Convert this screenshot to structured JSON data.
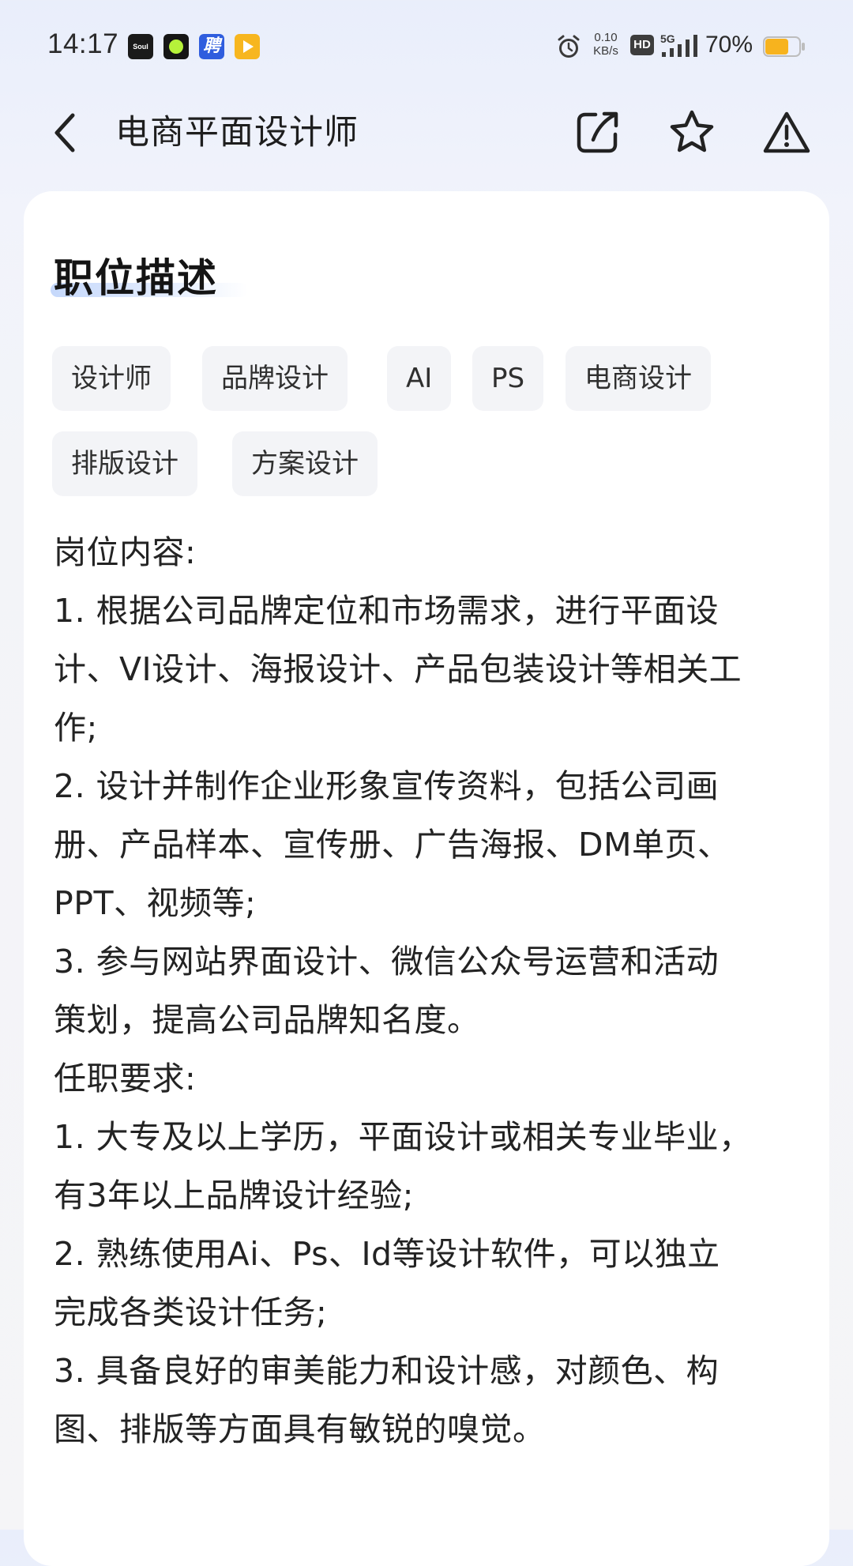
{
  "status_bar": {
    "time": "14:17",
    "notification_icons": [
      "soul-app-icon",
      "circle-app-icon",
      "recruit-app-icon",
      "video-app-icon"
    ],
    "soul_label": "Soul",
    "recruit_label": "聘",
    "net_speed_value": "0.10",
    "net_speed_unit": "KB/s",
    "hd_label": "HD",
    "network_label": "5G",
    "battery_percent": "70%",
    "battery_level": 0.7,
    "battery_color": "#f7b31e"
  },
  "nav": {
    "title": "电商平面设计师",
    "actions": [
      "back-arrow-icon",
      "share-icon",
      "star-icon",
      "warning-icon"
    ]
  },
  "section": {
    "title": "职位描述",
    "accent_color": "#c5d8fb"
  },
  "tags": [
    "设计师",
    "品牌设计",
    "AI",
    "PS",
    "电商设计",
    "排版设计",
    "方案设计"
  ],
  "description_lines": [
    "岗位内容:",
    "1. 根据公司品牌定位和市场需求，进行平面设",
    "计、VI设计、海报设计、产品包装设计等相关工",
    "作;",
    "2. 设计并制作企业形象宣传资料，包括公司画",
    "册、产品样本、宣传册、广告海报、DM单页、",
    "PPT、视频等;",
    "3. 参与网站界面设计、微信公众号运营和活动",
    "策划，提高公司品牌知名度。",
    "任职要求:",
    "1. 大专及以上学历，平面设计或相关专业毕业，",
    "有3年以上品牌设计经验;",
    "2. 熟练使用Ai、Ps、Id等设计软件，可以独立",
    "完成各类设计任务;",
    "3. 具备良好的审美能力和设计感，对颜色、构",
    "图、排版等方面具有敏锐的嗅觉。"
  ]
}
